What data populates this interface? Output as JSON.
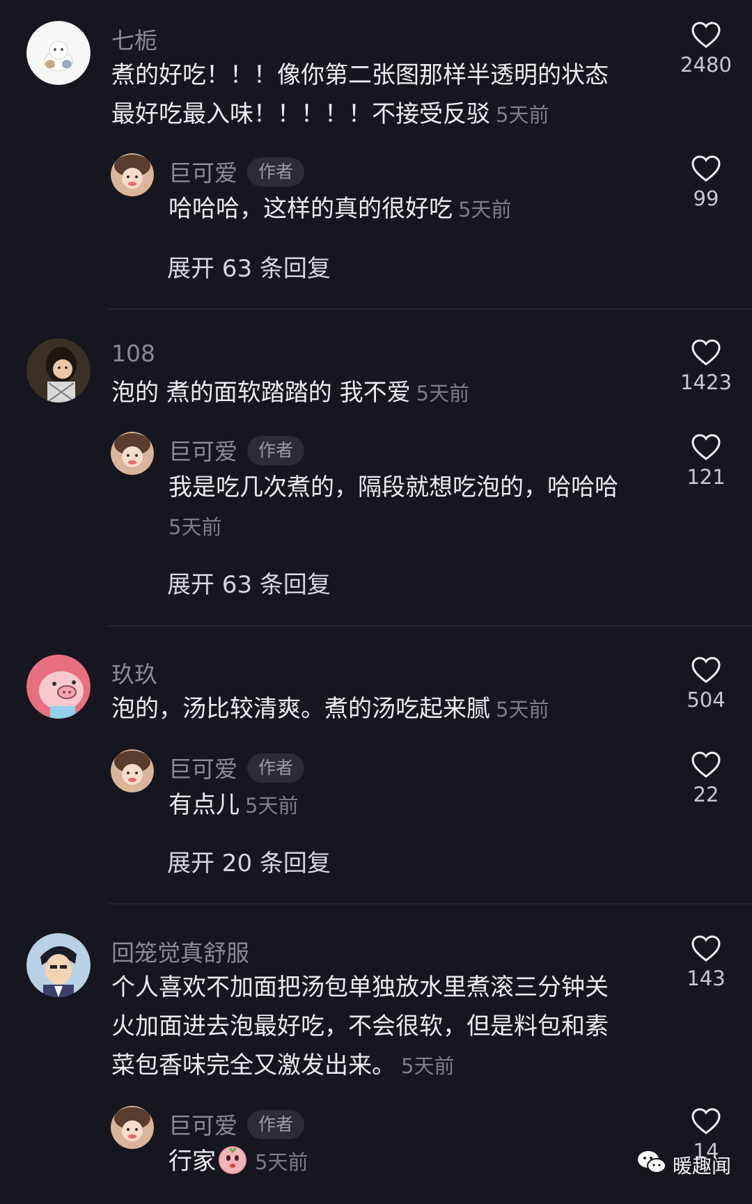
{
  "author_badge": "作者",
  "time_label": "5天前",
  "threads": [
    {
      "comment": {
        "user": "七栀",
        "text": "煮的好吃！！！像你第二张图那样半透明的状态最好吃最入味！！！！！不接受反驳",
        "line1": "煮的好吃！！！像你第二张图那样半透明的状态",
        "line2": "最好吃最入味！！！！！不接受反驳",
        "likes": "2480"
      },
      "reply": {
        "user": "巨可爱",
        "text": "哈哈哈，这样的真的很好吃",
        "likes": "99"
      },
      "expand": "展开 63 条回复"
    },
    {
      "comment": {
        "user": "108",
        "text": "泡的 煮的面软踏踏的 我不爱",
        "likes": "1423"
      },
      "reply": {
        "user": "巨可爱",
        "text": "我是吃几次煮的，隔段就想吃泡的，哈哈哈",
        "likes": "121"
      },
      "expand": "展开 63 条回复"
    },
    {
      "comment": {
        "user": "玖玖",
        "text": "泡的，汤比较清爽。煮的汤吃起来腻",
        "likes": "504"
      },
      "reply": {
        "user": "巨可爱",
        "text": "有点儿",
        "likes": "22"
      },
      "expand": "展开 20 条回复"
    },
    {
      "comment": {
        "user": "回笼觉真舒服",
        "line1": "个人喜欢不加面把汤包单独放水里煮滚三分钟关",
        "line2": "火加面进去泡最好吃，不会很软，但是料包和素",
        "line3": "菜包香味完全又激发出来。",
        "likes": "143"
      },
      "reply": {
        "user": "巨可爱",
        "text": "行家",
        "likes": "14"
      }
    }
  ],
  "watermark": "暖趣闻",
  "colors": {
    "background": "#16161e",
    "username": "#8a8a93",
    "text": "#ececf0",
    "time": "#7d7d86",
    "badge_bg": "#2c2c35"
  }
}
